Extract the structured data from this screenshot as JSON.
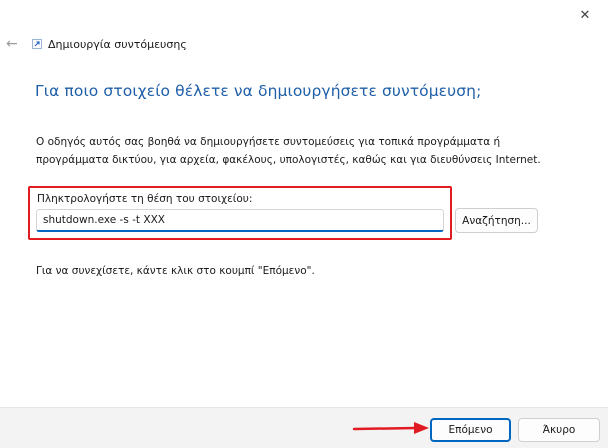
{
  "window": {
    "close_glyph": "✕"
  },
  "header": {
    "back_glyph": "←",
    "title": "Δημιουργία συντόμευσης"
  },
  "main": {
    "heading": "Για ποιο στοιχείο θέλετε να δημιουργήσετε συντόμευση;",
    "description": "Ο οδηγός αυτός σας βοηθά να δημιουργήσετε συντομεύσεις για τοπικά προγράμματα ή προγράμματα δικτύου, για αρχεία, φακέλους, υπολογιστές, καθώς και για διευθύνσεις Internet.",
    "location_label": "Πληκτρολογήστε τη θέση του στοιχείου:",
    "location_value": "shutdown.exe -s -t XXX",
    "browse_label": "Αναζήτηση...",
    "continue_text": "Για να συνεχίσετε, κάντε κλικ στο κουμπί \"Επόμενο\"."
  },
  "footer": {
    "next_label": "Επόμενο",
    "cancel_label": "Άκυρο"
  },
  "colors": {
    "accent": "#0067c0",
    "heading": "#1f5fa8",
    "highlight": "#e11b22"
  }
}
